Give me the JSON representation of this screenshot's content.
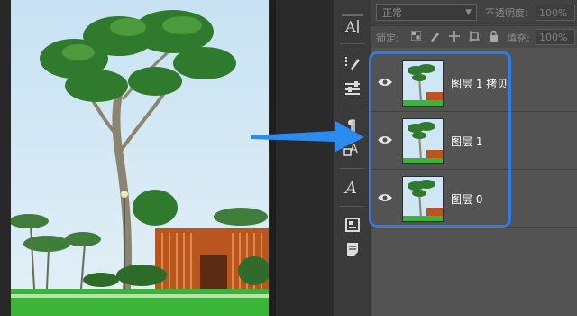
{
  "options": {
    "blend_mode": "正常",
    "opacity_label": "不透明度:",
    "opacity_value": "100%",
    "lock_label": "锁定:",
    "fill_label": "填充:",
    "fill_value": "100%"
  },
  "layers": [
    {
      "name": "图层 1 拷贝"
    },
    {
      "name": "图层 1"
    },
    {
      "name": "图层 0"
    }
  ],
  "tools": [
    "type-tool-icon",
    "brush-settings-icon",
    "adjustments-icon",
    "paragraph-icon",
    "character-icon",
    "glyph-icon",
    "info-panel-icon",
    "notes-icon"
  ],
  "colors": {
    "highlight": "#2d7be8",
    "arrow": "#2b8cf0"
  }
}
